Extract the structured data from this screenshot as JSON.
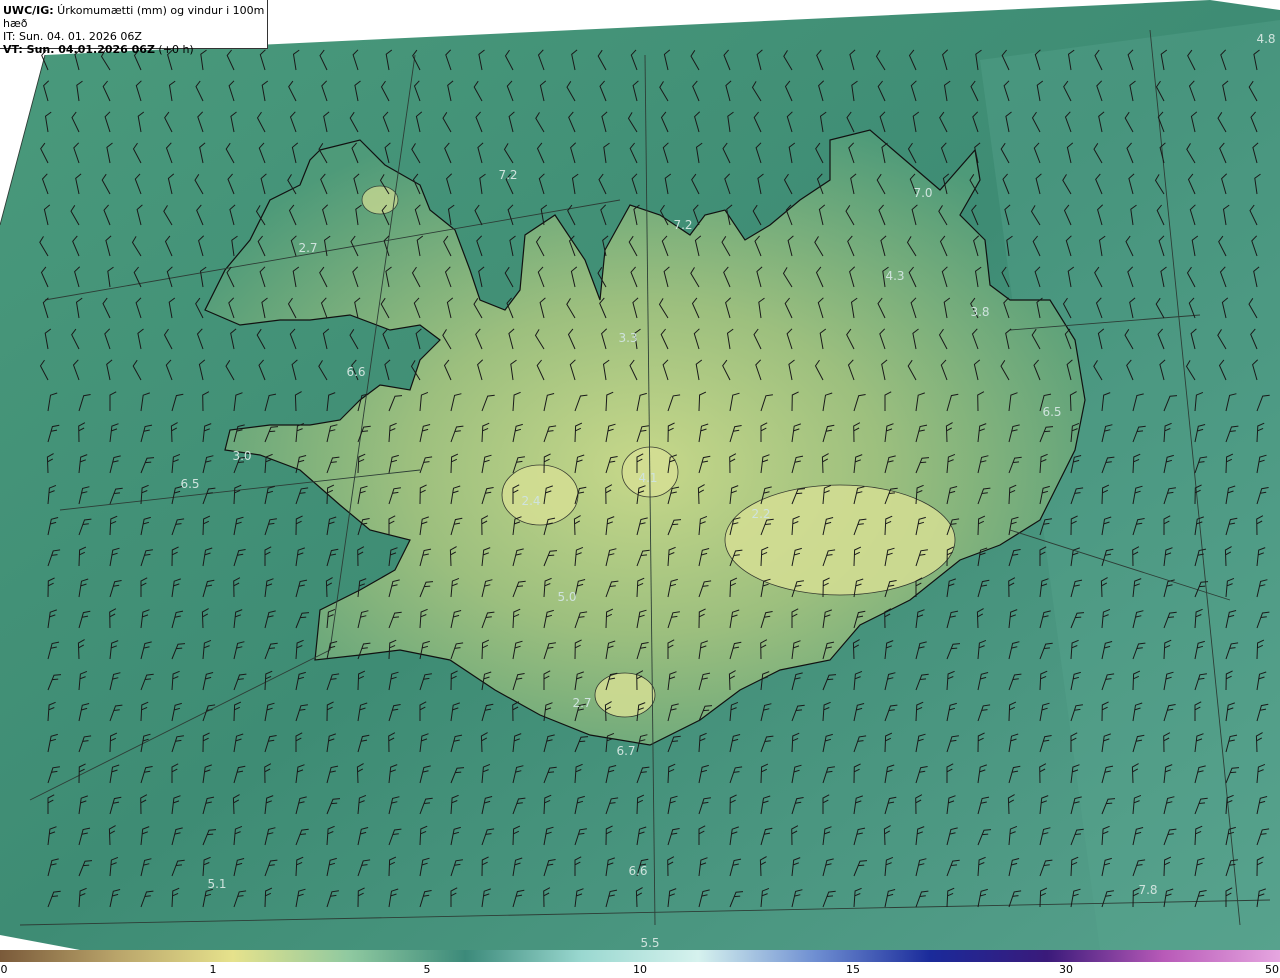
{
  "header": {
    "title_prefix": "UWC/IG:",
    "title_rest": " Úrkomumætti (mm) og vindur i 100m hæð",
    "it_line": "IT: Sun. 04. 01. 2026 06Z",
    "vt_prefix": "VT: Sun. 04.01.2026 06Z",
    "vt_rest": " (+0 h)"
  },
  "map": {
    "ocean_color": "#3f8a72",
    "land_low_color": "#4f9a78",
    "land_high_color": "#c9d98a",
    "coast_color": "#111111",
    "grid_color": "#2d3d36",
    "barb_color": "#1a1a1a",
    "value_labels": [
      "4.8",
      "7.2",
      "7.0",
      "7.2",
      "2.7",
      "4.3",
      "3.8",
      "3.3",
      "6.6",
      "6.5",
      "3.0",
      "6.5",
      "4.1",
      "2.4",
      "2.2",
      "5.0",
      "2.7",
      "6.7",
      "6.6",
      "5.1",
      "7.8",
      "5.5"
    ]
  },
  "colorbar": {
    "ticks": [
      "0",
      "1",
      "5",
      "10",
      "15",
      "30",
      "50"
    ],
    "stops": [
      "#7a5a3a",
      "#b9a46a",
      "#e6e28c",
      "#8fc9a0",
      "#3c8a7a",
      "#9ad8d0",
      "#d6f2ee",
      "#6f8fd2",
      "#1a2a9a",
      "#3a1a7a",
      "#b85ab8",
      "#e6a6e0"
    ]
  }
}
